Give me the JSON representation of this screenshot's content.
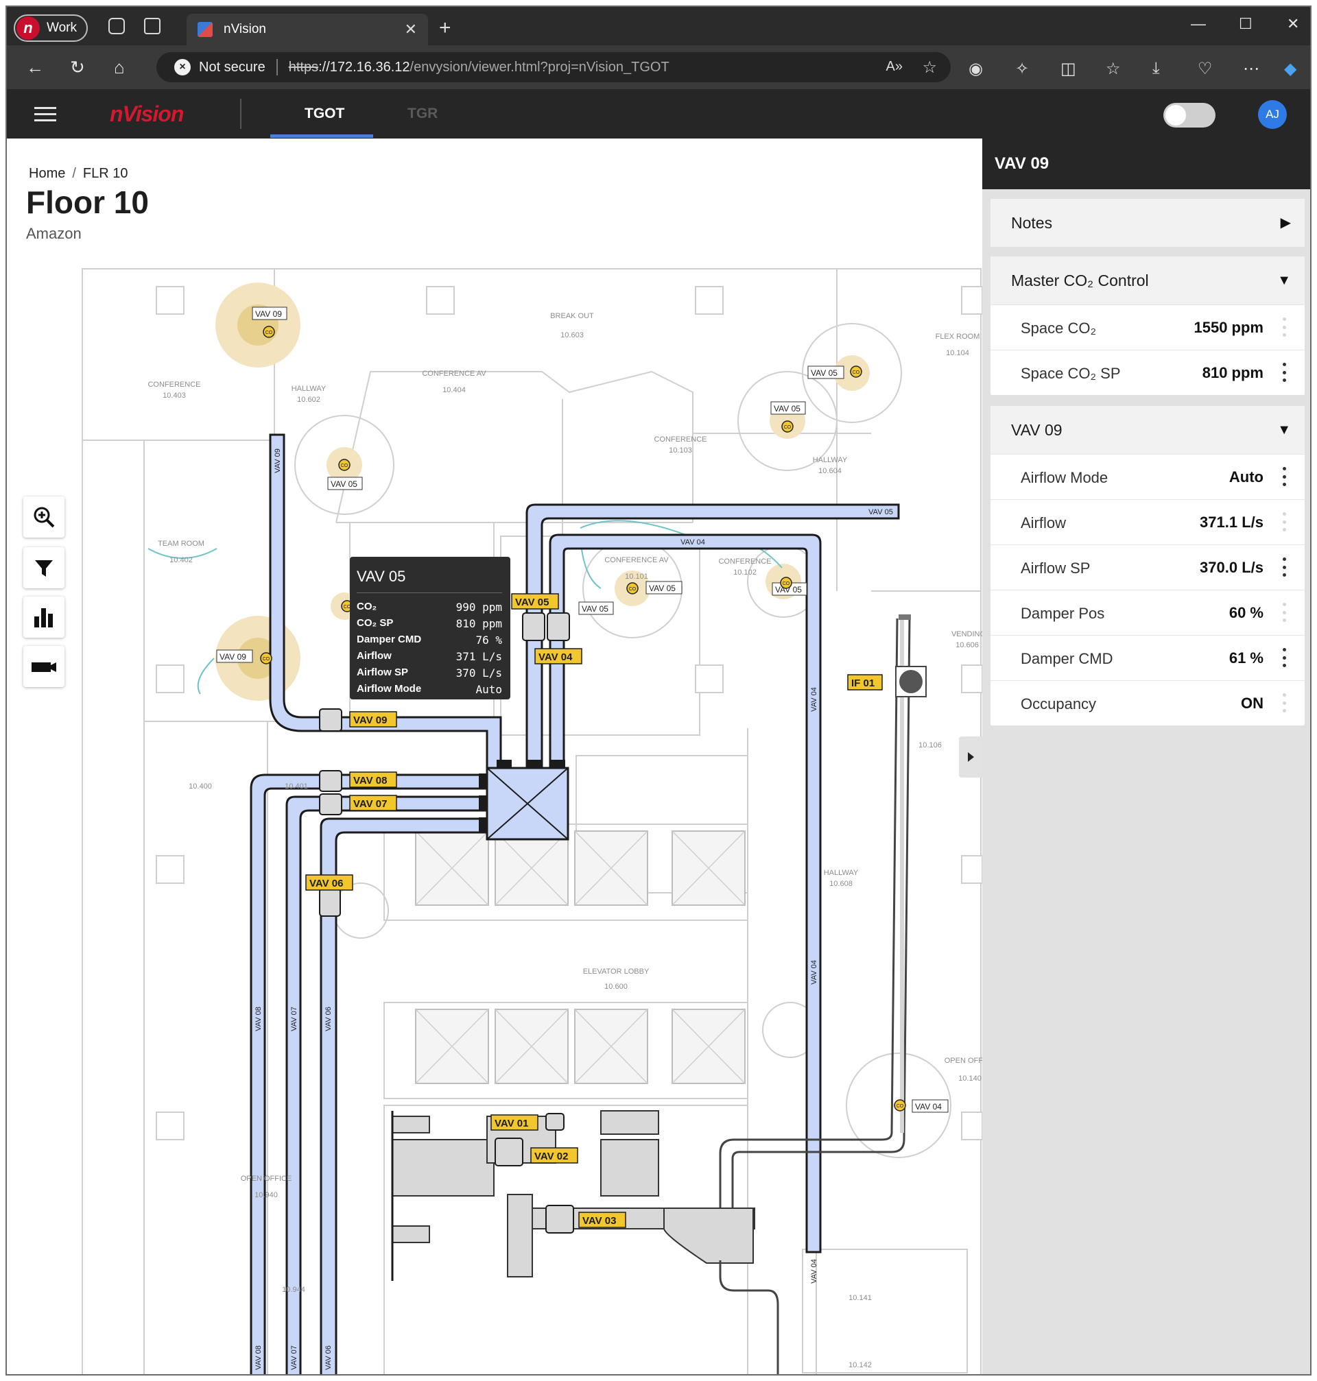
{
  "browser": {
    "profile_label": "Work",
    "tab_title": "nVision",
    "tab_close": "✕",
    "new_tab": "+",
    "security_label": "Not secure",
    "url_scheme": "https",
    "url_host": "://172.16.36.12",
    "url_path": "/envysion/viewer.html?proj=nVision_TGOT",
    "controls": {
      "minimize": "—",
      "maximize": "☐",
      "close": "✕"
    }
  },
  "app": {
    "brand": "nVision",
    "tabs": [
      {
        "label": "TGOT",
        "active": true
      },
      {
        "label": "TGR",
        "active": false
      }
    ],
    "user_initials": "AJ",
    "accent_color": "#4a7fd9",
    "brand_color": "#d3192f"
  },
  "page": {
    "breadcrumb": [
      "Home",
      "FLR 10"
    ],
    "title": "Floor 10",
    "subtitle": "Amazon"
  },
  "floorplan": {
    "rooms": [
      {
        "name": "CONFERENCE",
        "id": "10.403"
      },
      {
        "name": "HALLWAY",
        "id": "10.602"
      },
      {
        "name": "CONFERENCE AV",
        "id": "10.404"
      },
      {
        "name": "BREAK OUT",
        "id": "10.603"
      },
      {
        "name": "FLEX ROOM",
        "id": "10.104"
      },
      {
        "name": "CONFERENCE",
        "id": "10.103"
      },
      {
        "name": "HALLWAY",
        "id": "10.604"
      },
      {
        "name": "TEAM ROOM",
        "id": "10.402"
      },
      {
        "name": "CONFERENCE AV",
        "id": "10.101"
      },
      {
        "name": "CONFERENCE",
        "id": "10.102"
      },
      {
        "name": "VENDING",
        "id": "10.606"
      },
      {
        "name": "",
        "id": "10.106"
      },
      {
        "name": "",
        "id": "10.400"
      },
      {
        "name": "",
        "id": "10.401"
      },
      {
        "name": "HALLWAY",
        "id": "10.608"
      },
      {
        "name": "ELEVATOR LOBBY",
        "id": "10.600"
      },
      {
        "name": "OPEN OFFICE",
        "id": "10.140"
      },
      {
        "name": "OPEN OFFICE",
        "id": "10.940"
      },
      {
        "name": "",
        "id": "10.944"
      },
      {
        "name": "",
        "id": "10.141"
      },
      {
        "name": "",
        "id": "10.142"
      }
    ],
    "vav_labels": {
      "vav09": "VAV 09",
      "vav08": "VAV 08",
      "vav07": "VAV 07",
      "vav06": "VAV 06",
      "vav05": "VAV 05",
      "vav04": "VAV 04",
      "vav01": "VAV 01",
      "vav02": "VAV 02",
      "vav03": "VAV 03",
      "if01": "IF 01"
    },
    "sensor_label": "CO"
  },
  "tooltip": {
    "title": "VAV 05",
    "rows": [
      {
        "label": "CO₂",
        "value": "990 ppm"
      },
      {
        "label": "CO₂ SP",
        "value": "810 ppm"
      },
      {
        "label": "Damper CMD",
        "value": "76 %"
      },
      {
        "label": "Airflow",
        "value": "371 L/s"
      },
      {
        "label": "Airflow SP",
        "value": "370 L/s"
      },
      {
        "label": "Airflow Mode",
        "value": "Auto"
      }
    ]
  },
  "panel": {
    "title": "VAV 09",
    "notes_label": "Notes",
    "master": {
      "title": "Master CO₂ Control",
      "rows": [
        {
          "label": "Space CO₂",
          "value": "1550 ppm",
          "menu": "faint"
        },
        {
          "label": "Space CO₂ SP",
          "value": "810 ppm",
          "menu": "dark"
        }
      ]
    },
    "vav": {
      "title": "VAV 09",
      "rows": [
        {
          "label": "Airflow Mode",
          "value": "Auto",
          "menu": "dark"
        },
        {
          "label": "Airflow",
          "value": "371.1 L/s",
          "menu": "faint"
        },
        {
          "label": "Airflow SP",
          "value": "370.0 L/s",
          "menu": "dark"
        },
        {
          "label": "Damper Pos",
          "value": "60 %",
          "menu": "faint"
        },
        {
          "label": "Damper CMD",
          "value": "61 %",
          "menu": "dark"
        },
        {
          "label": "Occupancy",
          "value": "ON",
          "menu": "faint"
        }
      ]
    }
  },
  "tools": [
    "zoom-in-icon",
    "filter-icon",
    "chart-icon",
    "camera-icon"
  ]
}
